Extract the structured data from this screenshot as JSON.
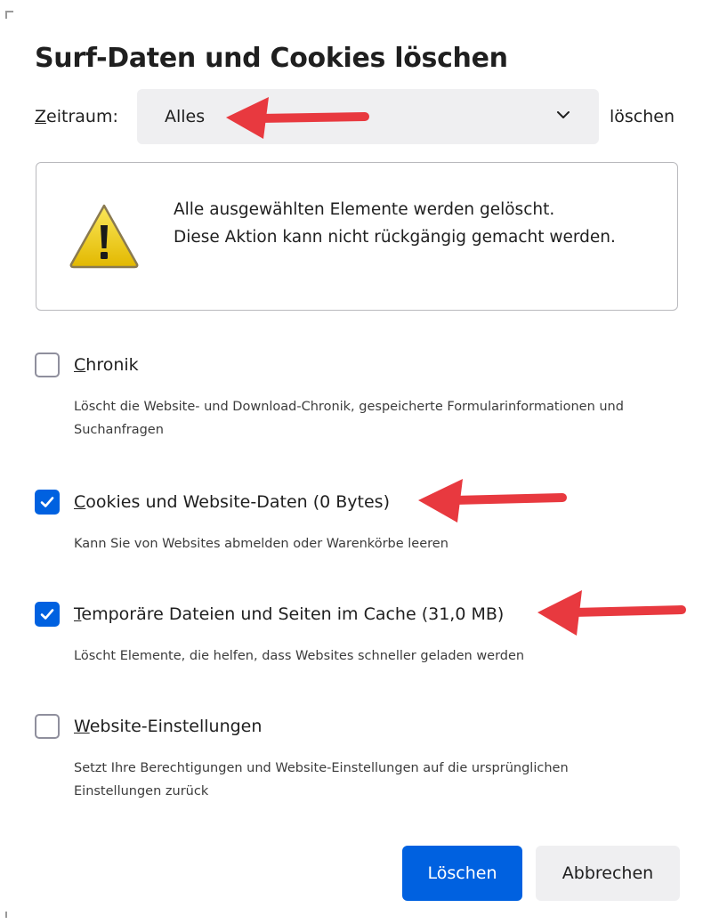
{
  "dialog": {
    "title": "Surf-Daten und Cookies löschen"
  },
  "time_range": {
    "label_first": "Z",
    "label_rest": "eitraum:",
    "selected": "Alles",
    "suffix": "löschen"
  },
  "warning": {
    "line1": "Alle ausgewählten Elemente werden gelöscht.",
    "line2": "Diese Aktion kann nicht rückgängig gemacht werden."
  },
  "options": [
    {
      "label_first": "C",
      "label_rest": "hronik",
      "description": "Löscht die Website- und Download-Chronik, gespeicherte Formularinformationen und Suchanfragen",
      "checked": false
    },
    {
      "label_first": "C",
      "label_rest": "ookies und Website-Daten (0 Bytes)",
      "description": "Kann Sie von Websites abmelden oder Warenkörbe leeren",
      "checked": true
    },
    {
      "label_first": "T",
      "label_rest": "emporäre Dateien und Seiten im Cache (31,0 MB)",
      "description": "Löscht Elemente, die helfen, dass Websites schneller geladen werden",
      "checked": true
    },
    {
      "label_first": "W",
      "label_rest": "ebsite-Einstellungen",
      "description": "Setzt Ihre Berechtigungen und Website-Einstellungen auf die ursprünglichen Einstellungen zurück",
      "checked": false
    }
  ],
  "buttons": {
    "confirm": "Löschen",
    "cancel": "Abbrechen"
  },
  "colors": {
    "accent": "#0061e0",
    "annotation_arrow": "#e8393f",
    "warning_yellow": "#f5d316"
  },
  "icons": {
    "warning": "warning-triangle-icon",
    "dropdown": "chevron-down-icon",
    "check": "checkmark-icon",
    "annotation": "red-arrow-icon"
  }
}
